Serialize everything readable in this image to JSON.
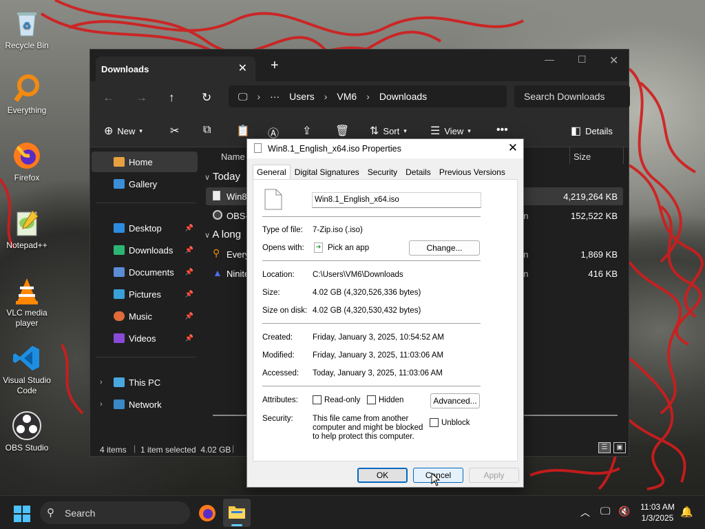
{
  "desktop": {
    "icons": [
      {
        "label": "Recycle Bin",
        "icon": "recycle-bin-icon"
      },
      {
        "label": "Everything",
        "icon": "everything-search-icon"
      },
      {
        "label": "Firefox",
        "icon": "firefox-icon"
      },
      {
        "label": "Notepad++",
        "icon": "notepad-plus-plus-icon"
      },
      {
        "label": "VLC media player",
        "icon": "vlc-icon"
      },
      {
        "label": "Visual Studio Code",
        "icon": "vscode-icon"
      },
      {
        "label": "OBS Studio",
        "icon": "obs-icon"
      }
    ]
  },
  "explorer": {
    "tab_title": "Downloads",
    "breadcrumb": [
      "Users",
      "VM6",
      "Downloads"
    ],
    "search_placeholder": "Search Downloads",
    "toolbar": {
      "new": "New",
      "sort": "Sort",
      "view": "View",
      "details": "Details"
    },
    "sidebar": [
      {
        "label": "Home",
        "selected": true,
        "icon": "home-icon"
      },
      {
        "label": "Gallery",
        "icon": "gallery-icon"
      },
      {
        "label": "Desktop",
        "pinned": true,
        "icon": "desktop-folder-icon"
      },
      {
        "label": "Downloads",
        "pinned": true,
        "icon": "downloads-folder-icon"
      },
      {
        "label": "Documents",
        "pinned": true,
        "icon": "documents-folder-icon"
      },
      {
        "label": "Pictures",
        "pinned": true,
        "icon": "pictures-folder-icon"
      },
      {
        "label": "Music",
        "pinned": true,
        "icon": "music-folder-icon"
      },
      {
        "label": "Videos",
        "pinned": true,
        "icon": "videos-folder-icon"
      },
      {
        "label": "This PC",
        "icon": "this-pc-icon"
      },
      {
        "label": "Network",
        "icon": "network-icon"
      }
    ],
    "columns": {
      "name": "Name",
      "size": "Size"
    },
    "groups": [
      {
        "label": "Today"
      },
      {
        "label": "A long"
      }
    ],
    "files": [
      {
        "name": "Win8.",
        "type": "",
        "size": "4,219,264 KB",
        "selected": true
      },
      {
        "name": "OBS-S",
        "type": "on",
        "size": "152,522 KB"
      },
      {
        "name": "Every",
        "type": "on",
        "size": "1,869 KB"
      },
      {
        "name": "Ninite",
        "type": "on",
        "size": "416 KB"
      }
    ],
    "status": {
      "items": "4 items",
      "selected": "1 item selected  4.02 GB"
    }
  },
  "dialog": {
    "title": "Win8.1_English_x64.iso Properties",
    "tabs": [
      "General",
      "Digital Signatures",
      "Security",
      "Details",
      "Previous Versions"
    ],
    "filename": "Win8.1_English_x64.iso",
    "type_label": "Type of file:",
    "type_value": "7-Zip.iso (.iso)",
    "opens_label": "Opens with:",
    "opens_value": "Pick an app",
    "change": "Change...",
    "location_label": "Location:",
    "location_value": "C:\\Users\\VM6\\Downloads",
    "size_label": "Size:",
    "size_value": "4.02 GB (4,320,526,336 bytes)",
    "disk_label": "Size on disk:",
    "disk_value": "4.02 GB (4,320,530,432 bytes)",
    "created_label": "Created:",
    "created_value": "Friday, January 3, 2025, 10:54:52 AM",
    "modified_label": "Modified:",
    "modified_value": "Friday, January 3, 2025, 11:03:06 AM",
    "accessed_label": "Accessed:",
    "accessed_value": "Today, January 3, 2025, 11:03:06 AM",
    "attributes_label": "Attributes:",
    "readonly": "Read-only",
    "hidden": "Hidden",
    "advanced": "Advanced...",
    "security_label": "Security:",
    "security_text": "This file came from another computer and might be blocked to help protect this computer.",
    "unblock": "Unblock",
    "ok": "OK",
    "cancel": "Cancel",
    "apply": "Apply"
  },
  "taskbar": {
    "search": "Search",
    "time": "11:03 AM",
    "date": "1/3/2025"
  }
}
